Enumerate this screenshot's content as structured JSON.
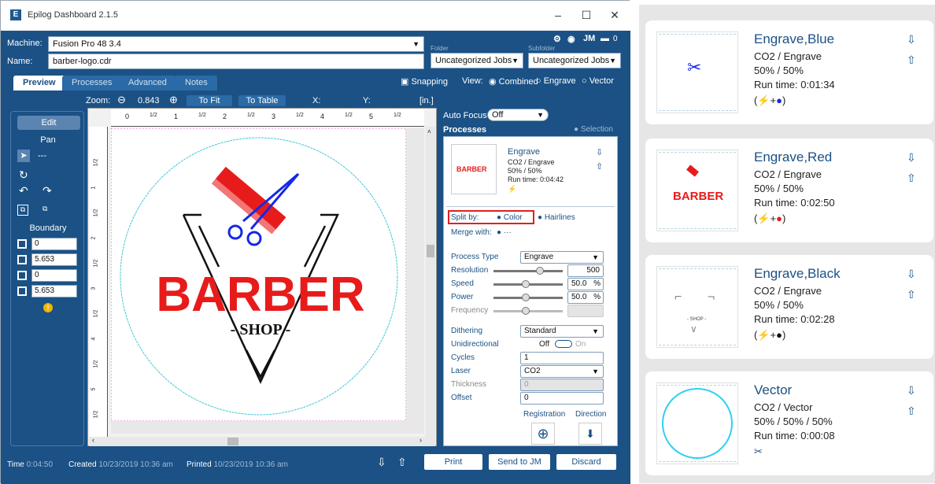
{
  "window": {
    "title": "Epilog Dashboard 2.1.5",
    "min": "–",
    "max": "☐",
    "close": "✕"
  },
  "header": {
    "machine_label": "Machine:",
    "machine_value": "Fusion Pro 48 3.4",
    "name_label": "Name:",
    "name_value": "barber-logo.cdr",
    "folder_label": "Folder",
    "folder_value": "Uncategorized Jobs",
    "subfolder_label": "Subfolder",
    "subfolder_value": "Uncategorized Jobs",
    "icons": [
      "gear-icon",
      "globe-icon",
      "jm-icon",
      "printer-icon"
    ],
    "jm_text": "JM",
    "printer_count": "0"
  },
  "tabs": [
    "Preview",
    "Processes",
    "Advanced",
    "Notes"
  ],
  "view": {
    "snapping": "Snapping",
    "view_label": "View:",
    "options": [
      "Combined",
      "Engrave",
      "Vector"
    ],
    "selected": "Combined"
  },
  "zoom": {
    "label": "Zoom:",
    "value": "0.843",
    "to_fit": "To Fit",
    "to_table": "To Table",
    "x_label": "X:",
    "y_label": "Y:",
    "unit": "[in.]"
  },
  "tools": {
    "edit": "Edit",
    "pan": "Pan",
    "dots": "---",
    "boundary": "Boundary",
    "values": [
      "0",
      "5.653",
      "0",
      "5.653"
    ]
  },
  "ruler": {
    "top": [
      "0",
      "1/2",
      "1",
      "1/2",
      "2",
      "1/2",
      "3",
      "1/2",
      "4",
      "1/2",
      "5",
      "1/2"
    ],
    "left": [
      "1/2",
      "1",
      "1/2",
      "2",
      "1/2",
      "3",
      "1/2",
      "4",
      "1/2",
      "5",
      "1/2"
    ]
  },
  "logo": {
    "word1": "BARBER",
    "word2": "- SHOP -"
  },
  "autofocus": {
    "label": "Auto Focus",
    "value": "Off"
  },
  "processes": {
    "title": "Processes",
    "selection": "Selection",
    "card": {
      "name": "Engrave",
      "type": "CO2 / Engrave",
      "pct": "50% / 50%",
      "runtime": "Run time: 0:04:42",
      "thumb_text": "BARBER"
    },
    "split_by": "Split by:",
    "color": "Color",
    "hairlines": "Hairlines",
    "merge_with": "Merge with:",
    "merge_dots": "···",
    "process_type_label": "Process Type",
    "process_type": "Engrave",
    "resolution_label": "Resolution",
    "resolution": "500",
    "speed_label": "Speed",
    "speed": "50.0",
    "speed_unit": "%",
    "power_label": "Power",
    "power": "50.0",
    "power_unit": "%",
    "frequency_label": "Frequency",
    "dithering_label": "Dithering",
    "dithering": "Standard",
    "unidirectional_label": "Unidirectional",
    "uni_off": "Off",
    "uni_on": "On",
    "cycles_label": "Cycles",
    "cycles": "1",
    "laser_label": "Laser",
    "laser": "CO2",
    "thickness_label": "Thickness",
    "thickness": "0",
    "offset_label": "Offset",
    "offset": "0",
    "registration": "Registration",
    "direction": "Direction"
  },
  "status": {
    "time_label": "Time",
    "time": "0:04:50",
    "created_label": "Created",
    "created": "10/23/2019 10:36 am",
    "printed_label": "Printed",
    "printed": "10/23/2019 10:36 am",
    "print": "Print",
    "send_jm": "Send to JM",
    "discard": "Discard"
  },
  "side_cards": [
    {
      "title": "Engrave,Blue",
      "type": "CO2 / Engrave",
      "pct": "50% / 50%",
      "runtime": "Run time: 0:01:34",
      "dot": "#1528e6",
      "kind": "engrave"
    },
    {
      "title": "Engrave,Red",
      "type": "CO2 / Engrave",
      "pct": "50% / 50%",
      "runtime": "Run time: 0:02:50",
      "dot": "#e81b1b",
      "kind": "engrave",
      "thumb_text": "BARBER"
    },
    {
      "title": "Engrave,Black",
      "type": "CO2 / Engrave",
      "pct": "50% / 50%",
      "runtime": "Run time: 0:02:28",
      "dot": "#111111",
      "kind": "engrave",
      "thumb_text": "- SHOP -"
    },
    {
      "title": "Vector",
      "type": "CO2 / Vector",
      "pct": "50% / 50% / 50%",
      "runtime": "Run time: 0:00:08",
      "kind": "vector"
    }
  ],
  "colors": {
    "brand": "#1b5185",
    "red": "#e81b1b",
    "blue": "#1528e6",
    "cyan": "#30c8e8"
  }
}
